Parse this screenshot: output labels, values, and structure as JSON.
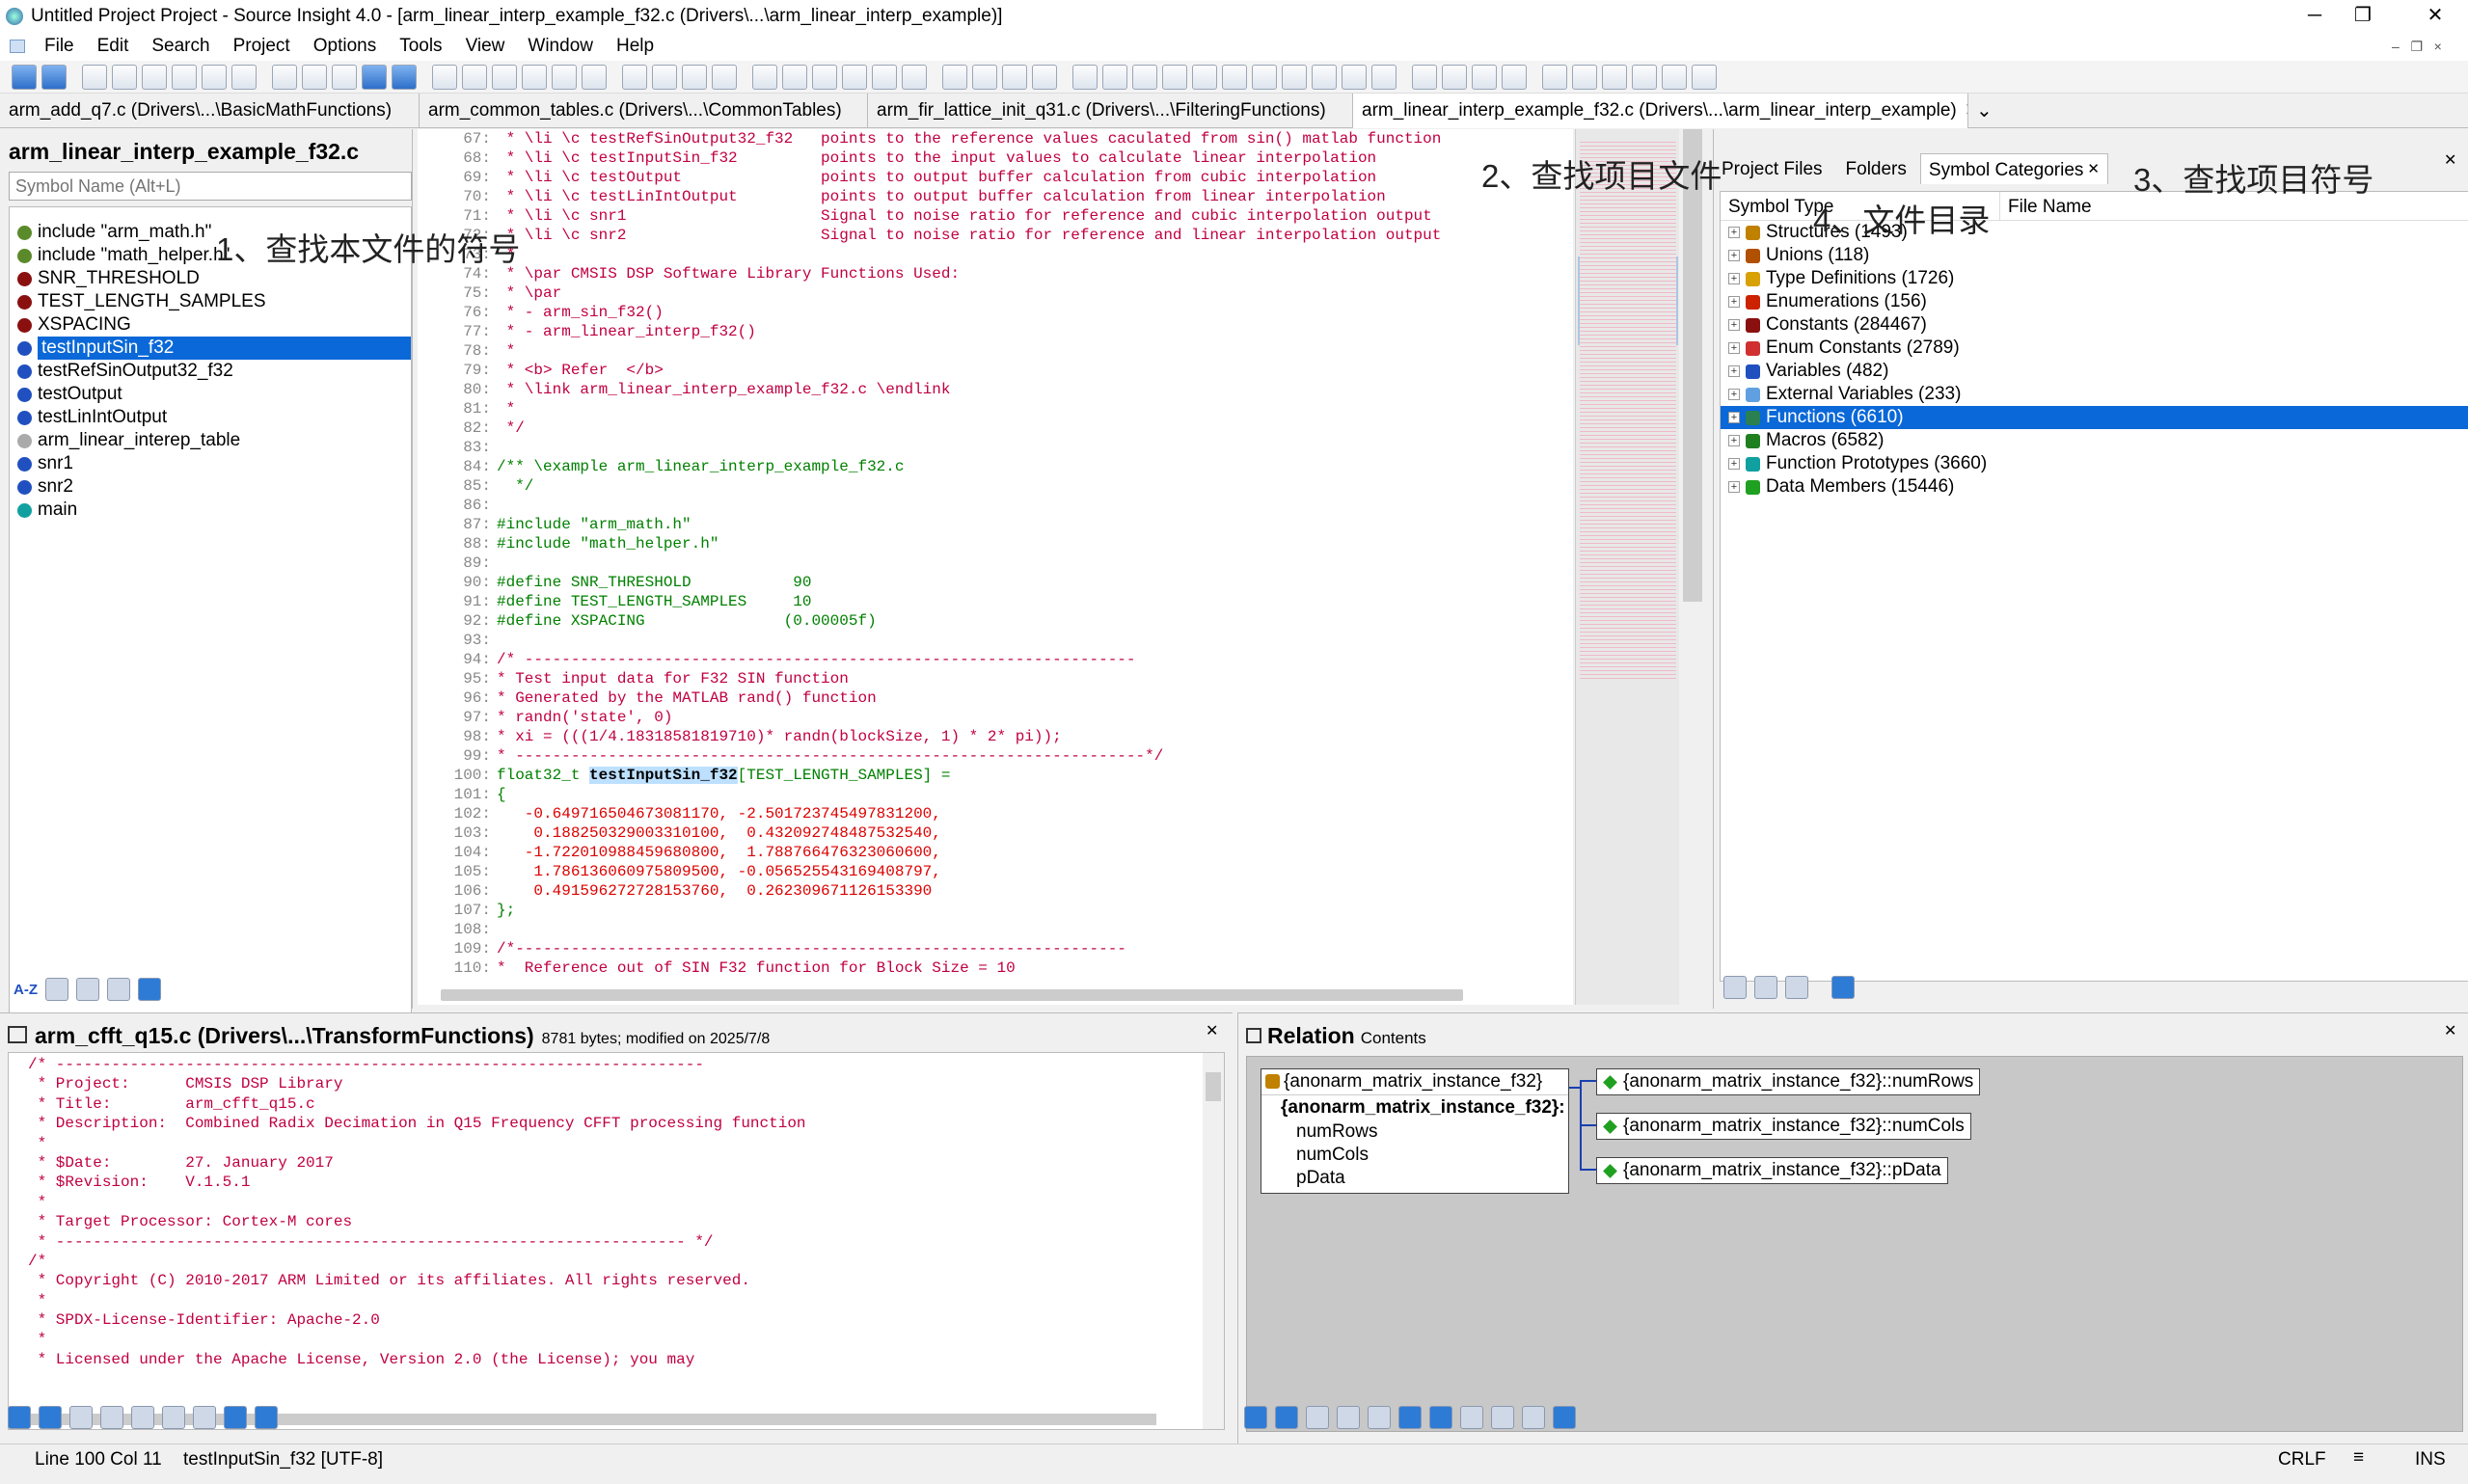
{
  "window": {
    "title": "Untitled Project Project - Source Insight 4.0 - [arm_linear_interp_example_f32.c (Drivers\\...\\arm_linear_interp_example)]",
    "min": "─",
    "max": "❐",
    "close": "✕"
  },
  "menu": [
    "File",
    "Edit",
    "Search",
    "Project",
    "Options",
    "Tools",
    "View",
    "Window",
    "Help"
  ],
  "tabs": [
    "arm_add_q7.c (Drivers\\...\\BasicMathFunctions)",
    "arm_common_tables.c (Drivers\\...\\CommonTables)",
    "arm_fir_lattice_init_q31.c (Drivers\\...\\FilteringFunctions)",
    "arm_linear_interp_example_f32.c (Drivers\\...\\arm_linear_interp_example)"
  ],
  "tab_close": "✕",
  "tab_more": "⌄",
  "symbol_panel": {
    "title": "arm_linear_interp_example_f32.c",
    "placeholder": "Symbol Name (Alt+L)",
    "items": [
      "include \"arm_math.h\"",
      "include \"math_helper.h\"",
      "SNR_THRESHOLD",
      "TEST_LENGTH_SAMPLES",
      "XSPACING",
      "testInputSin_f32",
      "testRefSinOutput32_f32",
      "testOutput",
      "testLinIntOutput",
      "arm_linear_interep_table",
      "snr1",
      "snr2",
      "main"
    ],
    "selected_index": 5,
    "sort_label": "A-Z"
  },
  "editor_lines": [
    {
      "n": "67:",
      "t": " * \\li \\c testRefSinOutput32_f32   points to the reference values caculated from sin() matlab function",
      "c": "cm"
    },
    {
      "n": "68:",
      "t": " * \\li \\c testInputSin_f32         points to the input values to calculate linear interpolation",
      "c": "cm"
    },
    {
      "n": "69:",
      "t": " * \\li \\c testOutput               points to output buffer calculation from cubic interpolation",
      "c": "cm"
    },
    {
      "n": "70:",
      "t": " * \\li \\c testLinIntOutput         points to output buffer calculation from linear interpolation",
      "c": "cm"
    },
    {
      "n": "71:",
      "t": " * \\li \\c snr1                     Signal to noise ratio for reference and cubic interpolation output",
      "c": "cm"
    },
    {
      "n": "72:",
      "t": " * \\li \\c snr2                     Signal to noise ratio for reference and linear interpolation output",
      "c": "cm"
    },
    {
      "n": "73:",
      "t": " *",
      "c": "cm"
    },
    {
      "n": "74:",
      "t": " * \\par CMSIS DSP Software Library Functions Used:",
      "c": "cm"
    },
    {
      "n": "75:",
      "t": " * \\par",
      "c": "cm"
    },
    {
      "n": "76:",
      "t": " * - arm_sin_f32()",
      "c": "cm"
    },
    {
      "n": "77:",
      "t": " * - arm_linear_interp_f32()",
      "c": "cm"
    },
    {
      "n": "78:",
      "t": " *",
      "c": "cm"
    },
    {
      "n": "79:",
      "t": " * <b> Refer  </b>",
      "c": "cm"
    },
    {
      "n": "80:",
      "t": " * \\link arm_linear_interp_example_f32.c \\endlink",
      "c": "cm"
    },
    {
      "n": "81:",
      "t": " *",
      "c": "cm"
    },
    {
      "n": "82:",
      "t": " */",
      "c": "cm"
    },
    {
      "n": "83:",
      "t": "",
      "c": ""
    },
    {
      "n": "84:",
      "t": "/** \\example arm_linear_interp_example_f32.c",
      "c": "def"
    },
    {
      "n": "85:",
      "t": "  */",
      "c": "def"
    },
    {
      "n": "86:",
      "t": "",
      "c": ""
    },
    {
      "n": "87:",
      "t": "#include \"arm_math.h\"",
      "c": "def"
    },
    {
      "n": "88:",
      "t": "#include \"math_helper.h\"",
      "c": "def"
    },
    {
      "n": "89:",
      "t": "",
      "c": ""
    },
    {
      "n": "90:",
      "t": "#define SNR_THRESHOLD           90",
      "c": "def"
    },
    {
      "n": "91:",
      "t": "#define TEST_LENGTH_SAMPLES     10",
      "c": "def"
    },
    {
      "n": "92:",
      "t": "#define XSPACING               (0.00005f)",
      "c": "def"
    },
    {
      "n": "93:",
      "t": "",
      "c": ""
    },
    {
      "n": "94:",
      "t": "/* ------------------------------------------------------------------",
      "c": "cm"
    },
    {
      "n": "95:",
      "t": "* Test input data for F32 SIN function",
      "c": "cm"
    },
    {
      "n": "96:",
      "t": "* Generated by the MATLAB rand() function",
      "c": "cm"
    },
    {
      "n": "97:",
      "t": "* randn('state', 0)",
      "c": "cm"
    },
    {
      "n": "98:",
      "t": "* xi = (((1/4.18318581819710)* randn(blockSize, 1) * 2* pi));",
      "c": "cm"
    },
    {
      "n": "99:",
      "t": "* --------------------------------------------------------------------*/",
      "c": "cm"
    },
    {
      "n": "100:",
      "t": "float32_t testInputSin_f32[TEST_LENGTH_SAMPLES] =",
      "c": "def"
    },
    {
      "n": "101:",
      "t": "{",
      "c": "def"
    },
    {
      "n": "102:",
      "t": "   -0.649716504673081170, -2.501723745497831200,",
      "c": "num"
    },
    {
      "n": "103:",
      "t": "    0.188250329003310100,  0.432092748487532540,",
      "c": "num"
    },
    {
      "n": "104:",
      "t": "   -1.722010988459680800,  1.788766476323060600,",
      "c": "num"
    },
    {
      "n": "105:",
      "t": "    1.786136060975809500, -0.056525543169408797,",
      "c": "num"
    },
    {
      "n": "106:",
      "t": "    0.491596272728153760,  0.262309671126153390",
      "c": "num"
    },
    {
      "n": "107:",
      "t": "};",
      "c": "def"
    },
    {
      "n": "108:",
      "t": "",
      "c": ""
    },
    {
      "n": "109:",
      "t": "/*------------------------------------------------------------------",
      "c": "cm"
    },
    {
      "n": "110:",
      "t": "*  Reference out of SIN F32 function for Block Size = 10",
      "c": "cm"
    }
  ],
  "project_panel": {
    "tabs": [
      "Project Files",
      "Folders",
      "Symbol Categories"
    ],
    "active_tab": 2,
    "close": "✕",
    "columns": [
      "Symbol Type",
      "File Name"
    ],
    "items": [
      {
        "label": "Structures (1493)",
        "color": "#c08000"
      },
      {
        "label": "Unions (118)",
        "color": "#b05000"
      },
      {
        "label": "Type Definitions (1726)",
        "color": "#d8a000"
      },
      {
        "label": "Enumerations (156)",
        "color": "#cc2200"
      },
      {
        "label": "Constants (284467)",
        "color": "#8a1010"
      },
      {
        "label": "Enum Constants (2789)",
        "color": "#d03030"
      },
      {
        "label": "Variables (482)",
        "color": "#2050c0"
      },
      {
        "label": "External Variables (233)",
        "color": "#60a0e0"
      },
      {
        "label": "Functions (6610)",
        "color": "#2a8050"
      },
      {
        "label": "Macros (6582)",
        "color": "#208020"
      },
      {
        "label": "Function Prototypes (3660)",
        "color": "#10a0a0"
      },
      {
        "label": "Data Members (15446)",
        "color": "#20a020"
      }
    ],
    "selected_index": 8
  },
  "context_panel": {
    "title": "arm_cfft_q15.c (Drivers\\...\\TransformFunctions)",
    "meta": "8781 bytes; modified on 2025/7/8",
    "close": "✕",
    "lines": [
      "/* ----------------------------------------------------------------------",
      " * Project:      CMSIS DSP Library",
      " * Title:        arm_cfft_q15.c",
      " * Description:  Combined Radix Decimation in Q15 Frequency CFFT processing function",
      " *",
      " * $Date:        27. January 2017",
      " * $Revision:    V.1.5.1",
      " *",
      " * Target Processor: Cortex-M cores",
      " * -------------------------------------------------------------------- */",
      "/*",
      " * Copyright (C) 2010-2017 ARM Limited or its affiliates. All rights reserved.",
      " *",
      " * SPDX-License-Identifier: Apache-2.0",
      " *",
      " * Licensed under the Apache License, Version 2.0 (the License); you may"
    ]
  },
  "relation_panel": {
    "title": "Relation",
    "subtitle": "Contents",
    "close": "✕",
    "root_top": "{anonarm_matrix_instance_f32}",
    "root_name": "{anonarm_matrix_instance_f32}:",
    "members": [
      "numRows",
      "numCols",
      "pData"
    ],
    "targets": [
      "{anonarm_matrix_instance_f32}::numRows",
      "{anonarm_matrix_instance_f32}::numCols",
      "{anonarm_matrix_instance_f32}::pData"
    ]
  },
  "status": {
    "position": "Line 100  Col 11",
    "symbol": "testInputSin_f32  [UTF-8]",
    "eol": "CRLF",
    "menu": "≡",
    "mode": "INS"
  },
  "annotations": [
    "1、查找本文件的符号",
    "2、查找项目文件",
    "3、查找项目符号",
    "4、文件目录"
  ]
}
